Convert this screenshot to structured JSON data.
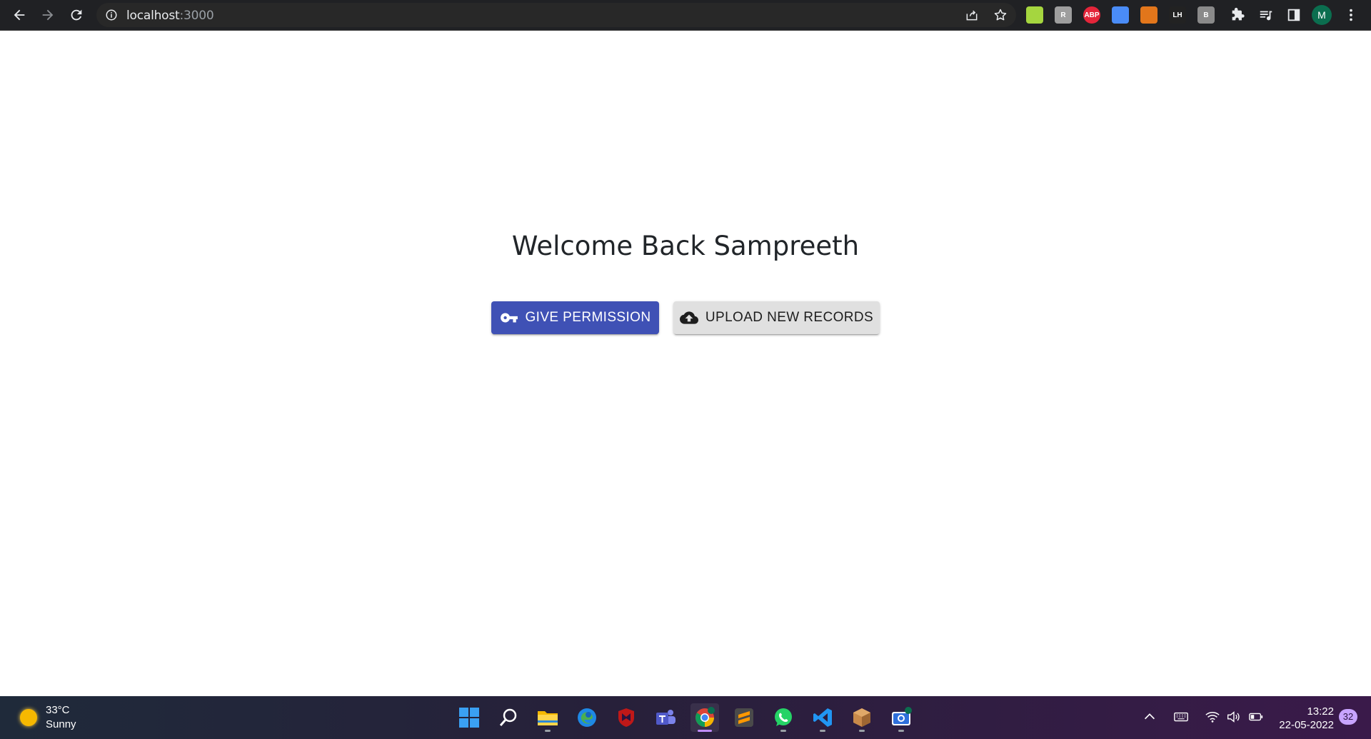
{
  "browser": {
    "url_host": "localhost",
    "url_port": ":3000",
    "profile_initial": "M",
    "extensions": [
      {
        "name": "image-ext-icon",
        "label": "",
        "color": "#a5d63f"
      },
      {
        "name": "rescuetime-ext-icon",
        "label": "R",
        "color": "#9e9e9e"
      },
      {
        "name": "adblock-plus-ext-icon",
        "label": "ABP",
        "color": "#e4253a"
      },
      {
        "name": "screen-capture-ext-icon",
        "label": "",
        "color": "#4a8cf7"
      },
      {
        "name": "metamask-ext-icon",
        "label": "",
        "color": "#e2761b"
      },
      {
        "name": "lighthouse-ext-icon",
        "label": "LH",
        "color": "#222222"
      },
      {
        "name": "reader-ext-icon",
        "label": "B",
        "color": "#8a8a8a"
      }
    ]
  },
  "page": {
    "heading": "Welcome Back Sampreeth",
    "give_permission_label": "GIVE PERMISSION",
    "upload_records_label": "UPLOAD NEW RECORDS",
    "primary_color": "#3f51b5"
  },
  "taskbar": {
    "temperature": "33°C",
    "condition": "Sunny",
    "time": "13:22",
    "date": "22-05-2022",
    "notification_count": "32"
  }
}
